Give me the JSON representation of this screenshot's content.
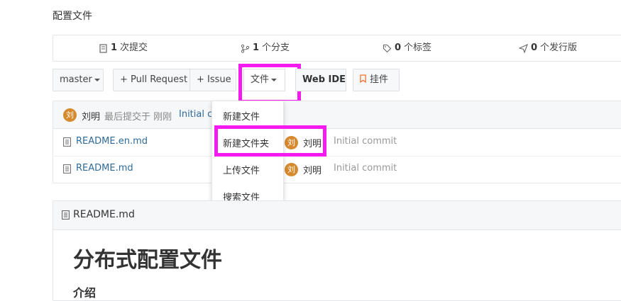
{
  "page": {
    "title": "配置文件"
  },
  "stats": {
    "commits": {
      "count": "1",
      "label": "次提交"
    },
    "branches": {
      "count": "1",
      "label": "个分支"
    },
    "tags": {
      "count": "0",
      "label": "个标签"
    },
    "releases": {
      "count": "0",
      "label": "个发行版"
    }
  },
  "toolbar": {
    "branch": "master",
    "pull_request": "+ Pull Request",
    "issue": "+ Issue",
    "file": "文件",
    "web_ide": "Web IDE",
    "pin": "挂件"
  },
  "dropdown": {
    "items": [
      "新建文件",
      "新建文件夹",
      "上传文件",
      "搜索文件"
    ]
  },
  "latest_commit": {
    "avatar": "刘",
    "author": "刘明",
    "meta": "最后提交于 刚刚",
    "message": "Initial co"
  },
  "files": [
    {
      "name": "README.en.md",
      "avatar": "刘",
      "author": "刘明",
      "message": "Initial commit"
    },
    {
      "name": "README.md",
      "avatar": "刘",
      "author": "刘明",
      "message": "Initial commit"
    }
  ],
  "readme": {
    "filename": "README.md",
    "heading": "分布式配置文件",
    "subheading": "介绍"
  },
  "colors": {
    "highlight": "#f51bf0",
    "avatar": "#d7892e",
    "link": "#2e6b9b",
    "pin": "#f0641e"
  },
  "icons": [
    "commit-icon",
    "branch-icon",
    "tag-icon",
    "release-icon",
    "bookmark-icon",
    "file-icon"
  ]
}
